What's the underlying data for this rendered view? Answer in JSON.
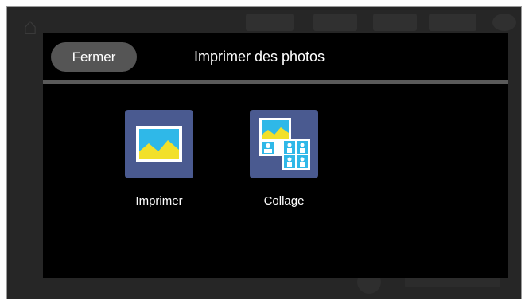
{
  "dialog": {
    "close_label": "Fermer",
    "title": "Imprimer des photos"
  },
  "tiles": [
    {
      "label": "Imprimer",
      "icon": "photo-icon"
    },
    {
      "label": "Collage",
      "icon": "collage-icon"
    }
  ],
  "colors": {
    "dialog_bg": "#000000",
    "button_bg": "#555555",
    "tile_bg": "#4a5a90",
    "image_sky": "#2fb8e8",
    "image_hill": "#f2e02a"
  }
}
